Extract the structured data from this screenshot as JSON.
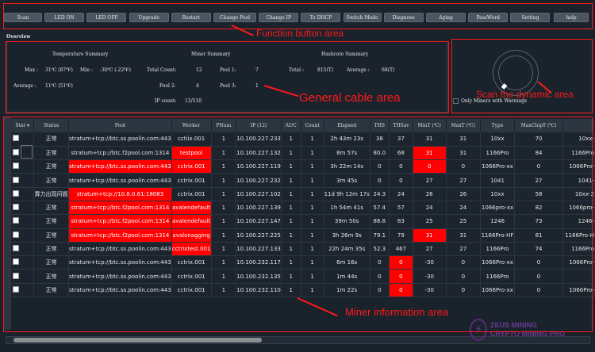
{
  "toolbar": {
    "buttons": [
      "Scan",
      "LED ON",
      "LED OFF",
      "Upgrade",
      "Restart",
      "Change Pool",
      "Change IP",
      "To DHCP",
      "Switch Mode",
      "Diagnose",
      "Aging",
      "PassWord",
      "Setting"
    ],
    "help": "help"
  },
  "overview": {
    "label": "Overview",
    "temperature": {
      "title": "Temperature Summary",
      "max_label": "Max :",
      "max_value": "31℃ (87℉)",
      "min_label": "Min :",
      "min_value": "-30℃ (-22℉)",
      "avg_label": "Average :",
      "avg_value": "11℃ (51℉)"
    },
    "miner": {
      "title": "Miner Summary",
      "total_label": "Total Count:",
      "total_value": "12",
      "pool1_label": "Pool 1:",
      "pool1_value": "7",
      "pool2_label": "Pool 2:",
      "pool2_value": "4",
      "pool3_label": "Pool 3:",
      "pool3_value": "1",
      "ip_label": "IP count:",
      "ip_value": "12/510"
    },
    "hashrate": {
      "title": "Hashrate Summary",
      "total_label": "Total :",
      "total_value": "815(T)",
      "avg_label": "Average :",
      "avg_value": "68(T)"
    }
  },
  "scan": {
    "only_warnings_label": "Only Miners with Warnings"
  },
  "table": {
    "headers": [
      "Stat",
      "Status",
      "Pool",
      "Worker",
      "PNum",
      "IP (12)",
      "AUC",
      "Count",
      "Elapsed",
      "THS",
      "THSav",
      "MinT (℃)",
      "MaxT (℃)",
      "Type",
      "MaxChipT (℃)",
      ""
    ],
    "rows": [
      [
        "正常",
        "stratum+tcp://btc.ss.poolin.com:443",
        "cctiix.001",
        "1",
        "10.100.227.233",
        "1",
        "1",
        "2h 43m 23s",
        "38",
        "37",
        "31",
        "31",
        "10xx",
        "70",
        "10xx-"
      ],
      [
        "正常",
        "stratum+tcp://btc.f2pool.com:1314",
        "testpool",
        "1",
        "10.100.227.132",
        "1",
        "1",
        "8m 57s",
        "80.0",
        "68",
        "31",
        "31",
        "1166Pro",
        "84",
        "1166Pro"
      ],
      [
        "正常",
        "stratum+tcp://btc.ss.poolin.com:443",
        "cctrix.001",
        "1",
        "10.100.227.119",
        "1",
        "1",
        "3h 22m 14s",
        "0",
        "0",
        "0",
        "0",
        "1066Pro-xx",
        "0",
        "1066Pro-"
      ],
      [
        "正常",
        "stratum+tcp://btc.ss.poolin.com:443",
        "cctrix.001",
        "1",
        "10.100.227.232",
        "1",
        "1",
        "3m 45s",
        "0",
        "0",
        "27",
        "27",
        "1041",
        "27",
        "1041-"
      ],
      [
        "算力出现问题",
        "stratum+tcp://10.8.0.61:18083",
        "cctrix.001",
        "1",
        "10.100.227.102",
        "1",
        "1",
        "11d 9h 12m 17s",
        "24.3",
        "24",
        "26",
        "26",
        "10xx",
        "58",
        "10xx-2"
      ],
      [
        "正常",
        "stratum+tcp://btc.f2pool.com:1314",
        "avalendefault",
        "1",
        "10.100.227.139",
        "1",
        "1",
        "1h 54m 41s",
        "57.4",
        "57",
        "24",
        "24",
        "1066pro-xx",
        "82",
        "1066pro-"
      ],
      [
        "正常",
        "stratum+tcp://btc.f2pool.com:1314",
        "avalendefault",
        "1",
        "10.100.227.147",
        "1",
        "1",
        "39m 50s",
        "86.8",
        "83",
        "25",
        "25",
        "1246",
        "73",
        "1246-"
      ],
      [
        "正常",
        "stratum+tcp://btc.f2pool.com:1314",
        "avalonagging",
        "1",
        "10.100.227.225",
        "1",
        "1",
        "3h 26m 9s",
        "79.1",
        "79",
        "31",
        "31",
        "1166Pro-HF",
        "81",
        "1166Pro-H"
      ],
      [
        "正常",
        "stratum+tcp://btc.ss.poolin.com:443",
        "cctrixtest.001",
        "1",
        "10.100.227.133",
        "1",
        "1",
        "22h 24m 35s",
        "52.3",
        "467",
        "27",
        "27",
        "1166Pro",
        "74",
        "1166Pro"
      ],
      [
        "正常",
        "stratum+tcp://btc.ss.poolin.com:443",
        "cctrix.001",
        "1",
        "10.100.232.117",
        "1",
        "1",
        "6m 16s",
        "0",
        "0",
        "-30",
        "0",
        "1066Pro-xx",
        "0",
        "1066Pro-"
      ],
      [
        "正常",
        "stratum+tcp://btc.ss.poolin.com:443",
        "cctrix.001",
        "1",
        "10.100.232.135",
        "1",
        "1",
        "1m 44s",
        "0",
        "0",
        "-30",
        "0",
        "1166Pro",
        "0",
        ""
      ],
      [
        "正常",
        "stratum+tcp://btc.ss.poolin.com:443",
        "cctrix.001",
        "1",
        "10.100.232.110",
        "1",
        "1",
        "1m 22s",
        "0",
        "0",
        "-30",
        "0",
        "1066Pro-xx",
        "0",
        "1066Pro-"
      ]
    ],
    "highlights": [
      [
        1,
        2
      ],
      [
        1,
        10
      ],
      [
        2,
        1
      ],
      [
        2,
        2
      ],
      [
        2,
        10
      ],
      [
        4,
        1
      ],
      [
        5,
        1
      ],
      [
        5,
        2
      ],
      [
        6,
        1
      ],
      [
        6,
        2
      ],
      [
        7,
        1
      ],
      [
        7,
        2
      ],
      [
        7,
        10
      ],
      [
        8,
        2
      ],
      [
        9,
        9
      ],
      [
        10,
        9
      ],
      [
        11,
        9
      ]
    ]
  },
  "annotations": {
    "function": "Function button area",
    "general": "General cable area",
    "scan": "Scan the dynamic area",
    "miner": "Miner information area"
  },
  "watermark": {
    "line1": "ZEUS MINING",
    "line2": "CRYPTO MINING PRO"
  },
  "colors": {
    "highlight": "#ff0000",
    "bg": "#1a222c"
  }
}
